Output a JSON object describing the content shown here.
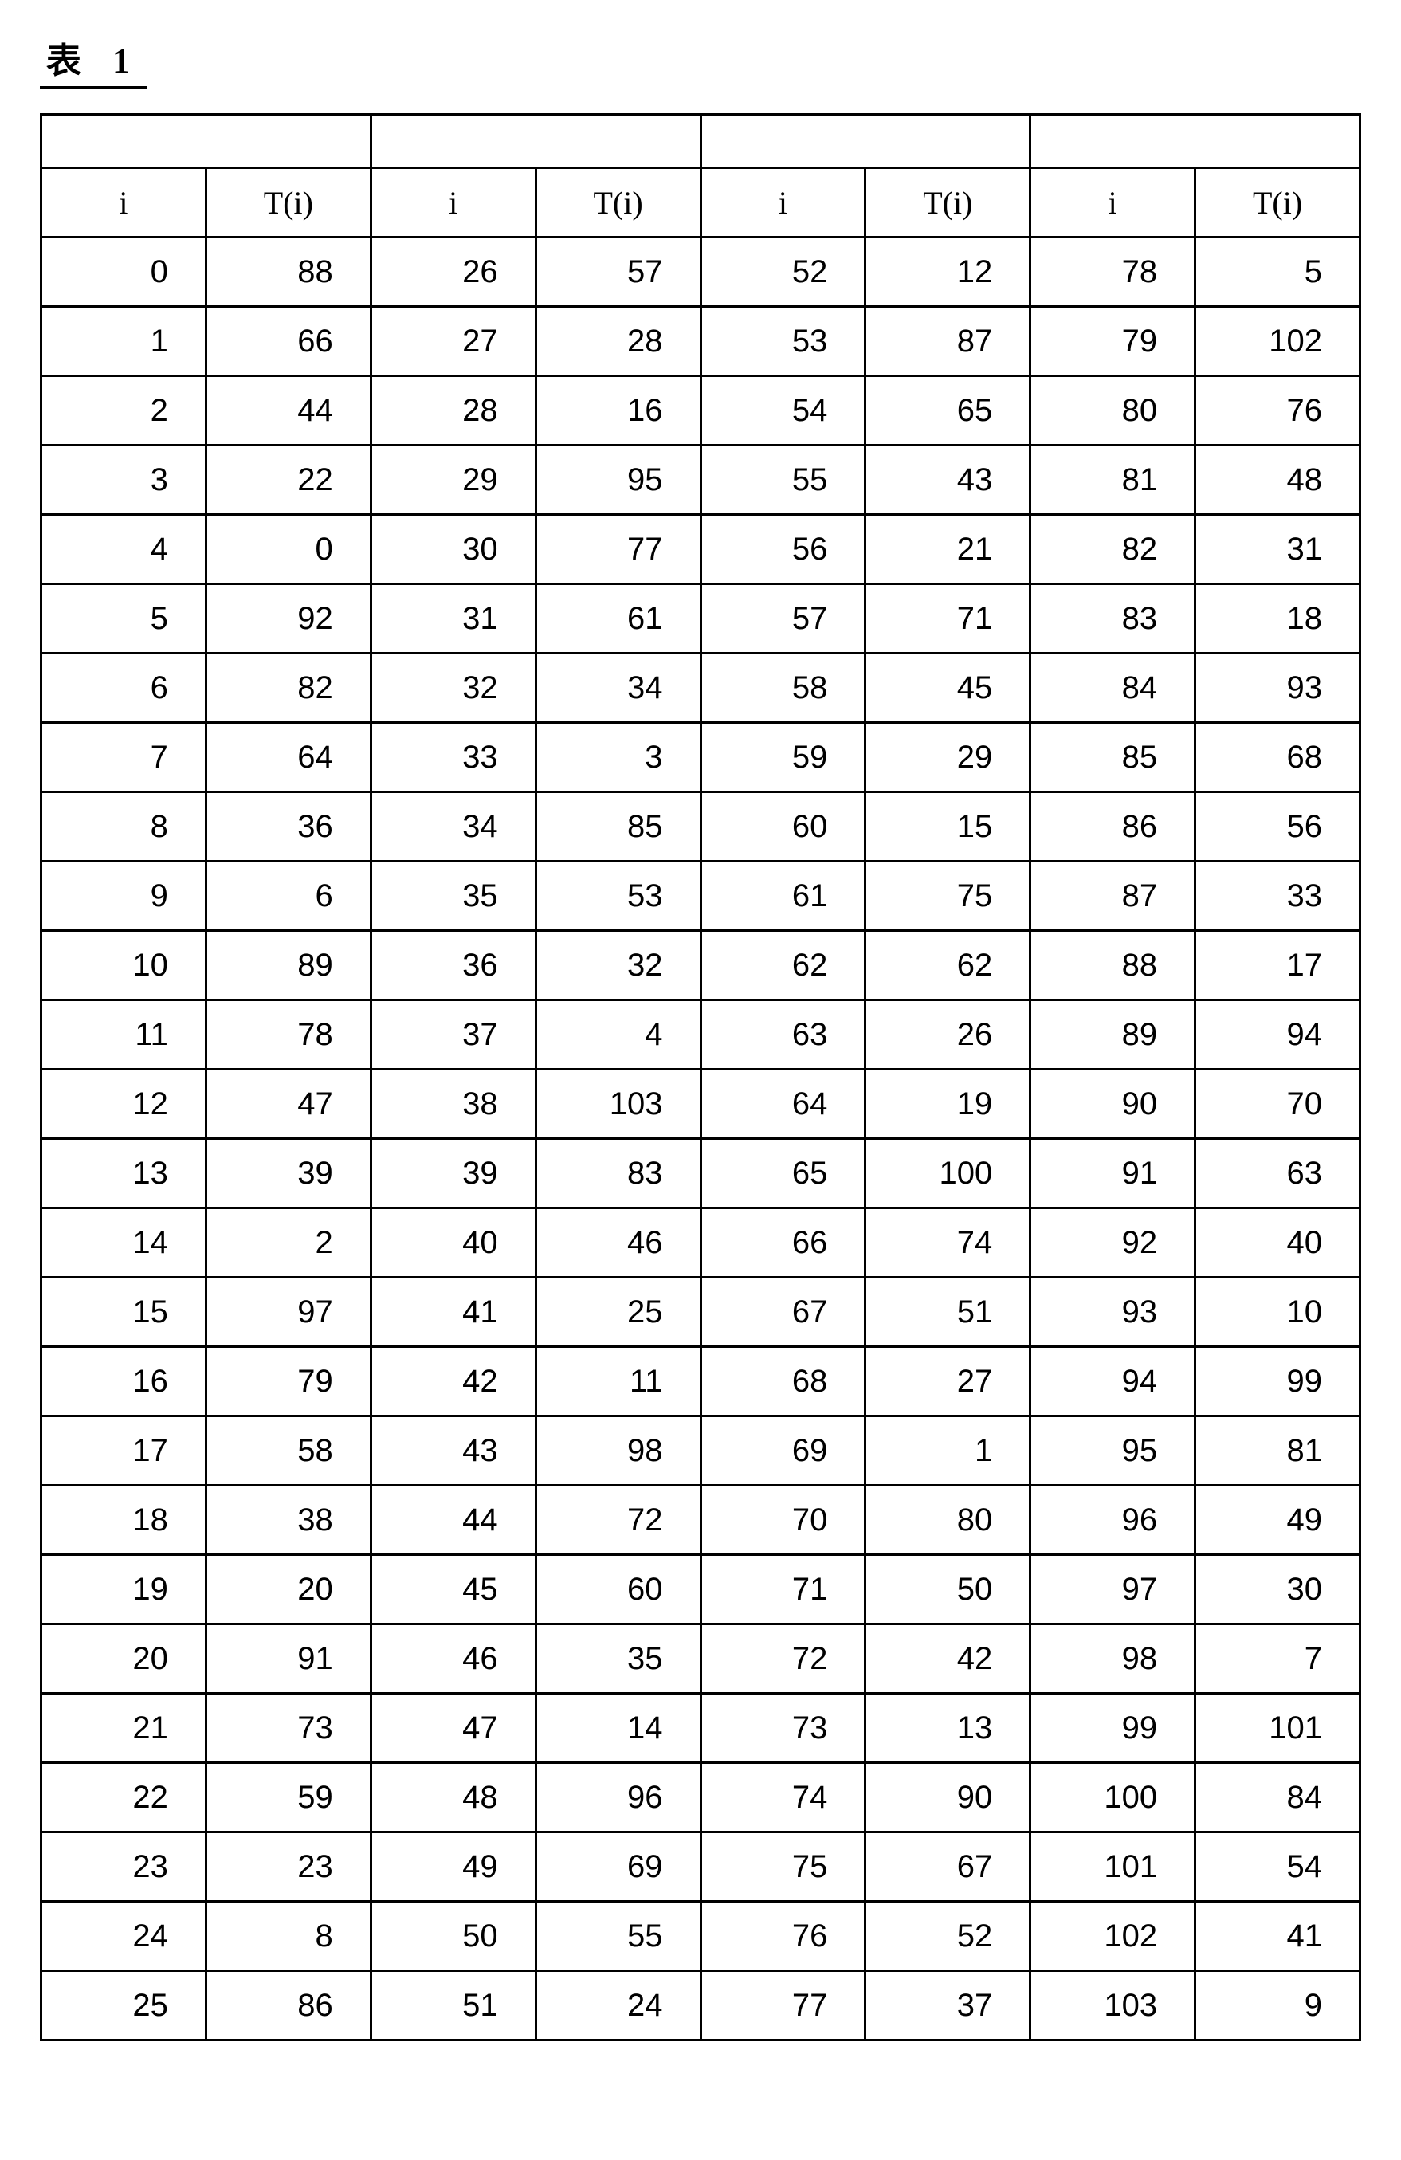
{
  "title": "表 1",
  "headers": [
    "i",
    "T(i)",
    "i",
    "T(i)",
    "i",
    "T(i)",
    "i",
    "T(i)"
  ],
  "rows": [
    [
      "0",
      "88",
      "26",
      "57",
      "52",
      "12",
      "78",
      "5"
    ],
    [
      "1",
      "66",
      "27",
      "28",
      "53",
      "87",
      "79",
      "102"
    ],
    [
      "2",
      "44",
      "28",
      "16",
      "54",
      "65",
      "80",
      "76"
    ],
    [
      "3",
      "22",
      "29",
      "95",
      "55",
      "43",
      "81",
      "48"
    ],
    [
      "4",
      "0",
      "30",
      "77",
      "56",
      "21",
      "82",
      "31"
    ],
    [
      "5",
      "92",
      "31",
      "61",
      "57",
      "71",
      "83",
      "18"
    ],
    [
      "6",
      "82",
      "32",
      "34",
      "58",
      "45",
      "84",
      "93"
    ],
    [
      "7",
      "64",
      "33",
      "3",
      "59",
      "29",
      "85",
      "68"
    ],
    [
      "8",
      "36",
      "34",
      "85",
      "60",
      "15",
      "86",
      "56"
    ],
    [
      "9",
      "6",
      "35",
      "53",
      "61",
      "75",
      "87",
      "33"
    ],
    [
      "10",
      "89",
      "36",
      "32",
      "62",
      "62",
      "88",
      "17"
    ],
    [
      "11",
      "78",
      "37",
      "4",
      "63",
      "26",
      "89",
      "94"
    ],
    [
      "12",
      "47",
      "38",
      "103",
      "64",
      "19",
      "90",
      "70"
    ],
    [
      "13",
      "39",
      "39",
      "83",
      "65",
      "100",
      "91",
      "63"
    ],
    [
      "14",
      "2",
      "40",
      "46",
      "66",
      "74",
      "92",
      "40"
    ],
    [
      "15",
      "97",
      "41",
      "25",
      "67",
      "51",
      "93",
      "10"
    ],
    [
      "16",
      "79",
      "42",
      "11",
      "68",
      "27",
      "94",
      "99"
    ],
    [
      "17",
      "58",
      "43",
      "98",
      "69",
      "1",
      "95",
      "81"
    ],
    [
      "18",
      "38",
      "44",
      "72",
      "70",
      "80",
      "96",
      "49"
    ],
    [
      "19",
      "20",
      "45",
      "60",
      "71",
      "50",
      "97",
      "30"
    ],
    [
      "20",
      "91",
      "46",
      "35",
      "72",
      "42",
      "98",
      "7"
    ],
    [
      "21",
      "73",
      "47",
      "14",
      "73",
      "13",
      "99",
      "101"
    ],
    [
      "22",
      "59",
      "48",
      "96",
      "74",
      "90",
      "100",
      "84"
    ],
    [
      "23",
      "23",
      "49",
      "69",
      "75",
      "67",
      "101",
      "54"
    ],
    [
      "24",
      "8",
      "50",
      "55",
      "76",
      "52",
      "102",
      "41"
    ],
    [
      "25",
      "86",
      "51",
      "24",
      "77",
      "37",
      "103",
      "9"
    ]
  ]
}
